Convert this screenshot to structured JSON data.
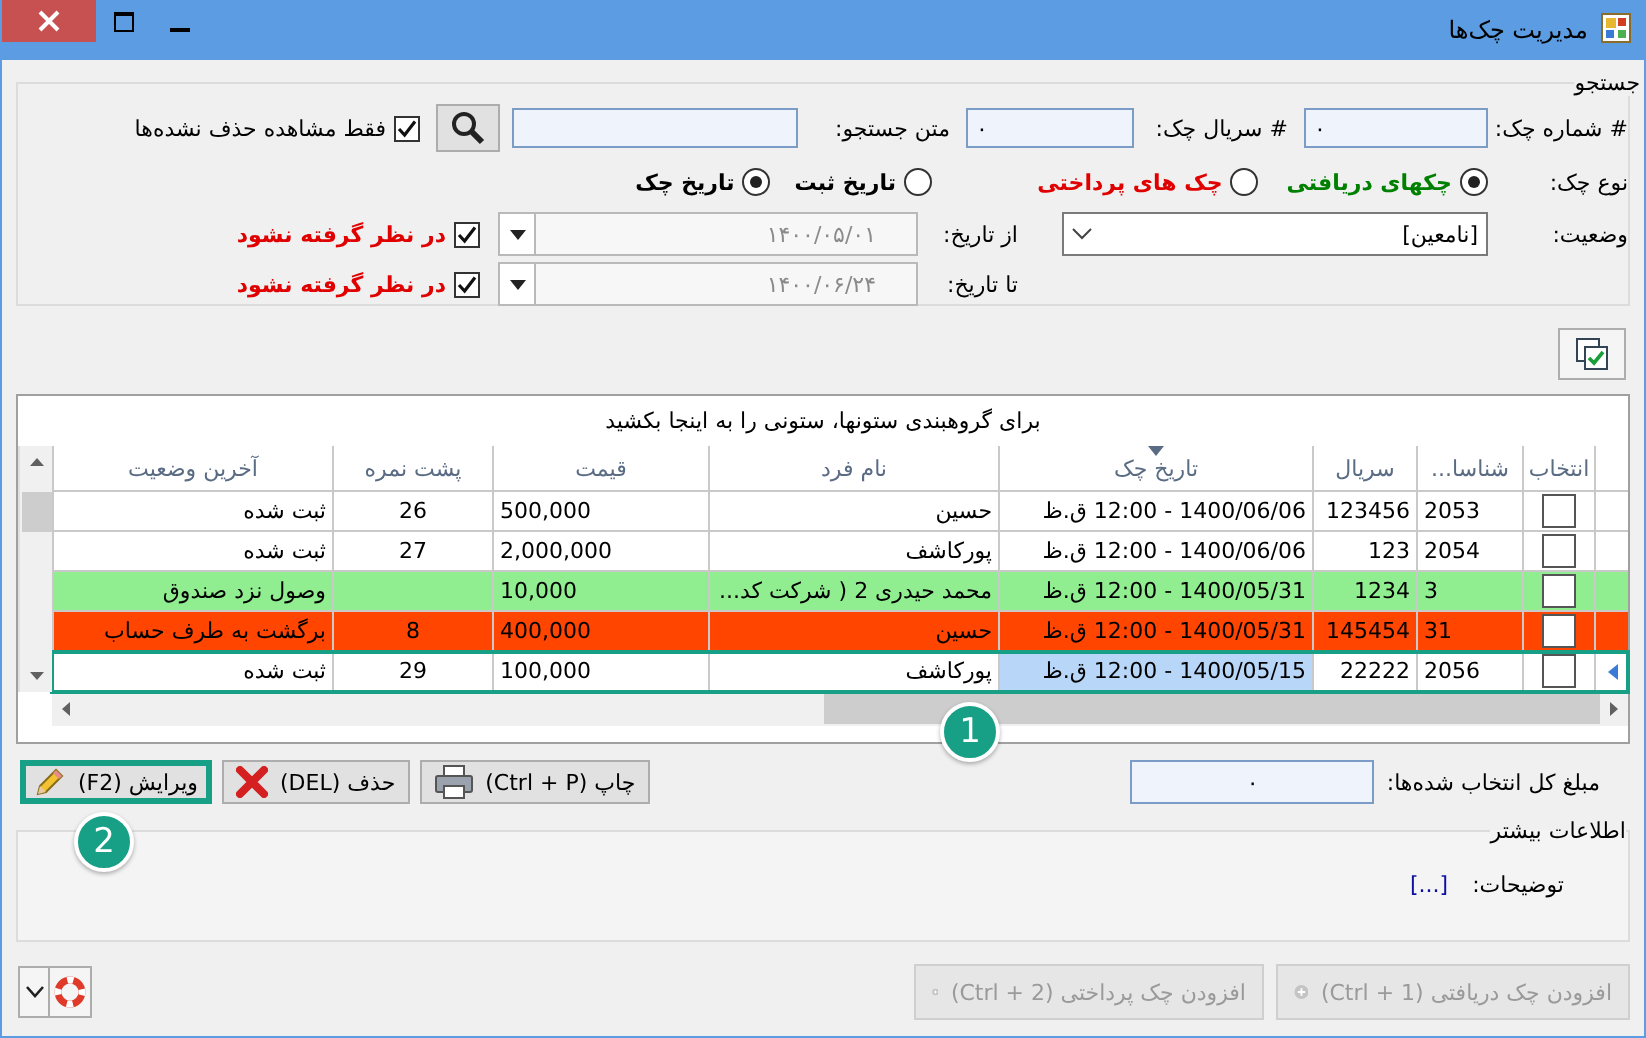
{
  "window": {
    "title": "مدیریت چک‌ها"
  },
  "search": {
    "title": "جستجو",
    "check_number": {
      "label": "# شماره چک:",
      "value": "۰"
    },
    "serial": {
      "label": "# سریال چک:",
      "value": "۰"
    },
    "text": {
      "label": "متن جستجو:"
    },
    "only_undeleted": {
      "label": "فقط مشاهده حذف نشده‌ها",
      "checked": true
    },
    "type": {
      "label": "نوع چک:",
      "options": [
        {
          "label": "چکهای دریافتی",
          "selected": true,
          "color": "#008000"
        },
        {
          "label": "چک های پرداختی",
          "selected": false,
          "color": "#e00000"
        }
      ]
    },
    "date_basis": {
      "options": [
        {
          "label": "تاریخ ثبت",
          "selected": false
        },
        {
          "label": "تاریخ چک",
          "selected": true
        }
      ]
    },
    "status": {
      "label": "وضعیت:",
      "value": "[نامعین]"
    },
    "dates": [
      {
        "label": "از تاریخ:",
        "value": "۱۴۰۰/۰۵/۰۱",
        "disabled": true,
        "ignore": {
          "label": "در نظر گرفته نشود",
          "checked": true
        }
      },
      {
        "label": "تا تاریخ:",
        "value": "۱۴۰۰/۰۶/۲۴",
        "disabled": true,
        "ignore": {
          "label": "در نظر گرفته نشود",
          "checked": true
        }
      }
    ]
  },
  "grid": {
    "group_hint": "برای گروهبندی ستونها، ستونی را به اینجا بکشید",
    "columns": [
      {
        "label": "انتخاب",
        "sorted": false
      },
      {
        "label": "شناسا...",
        "sorted": false
      },
      {
        "label": "سریال",
        "sorted": false
      },
      {
        "label": "تاریخ چک",
        "sorted": true
      },
      {
        "label": "نام فرد",
        "sorted": false
      },
      {
        "label": "قیمت",
        "sorted": false
      },
      {
        "label": "پشت نمره",
        "sorted": false
      },
      {
        "label": "آخرین وضعیت",
        "sorted": false
      }
    ],
    "rows": [
      {
        "selected": false,
        "highlighted": false,
        "cells": [
          {
            "checked": false
          },
          "2053",
          "123456",
          "1400/06/06 - 12:00 ق.ظ",
          "حسین",
          "500,000",
          "26",
          "ثبت شده"
        ]
      },
      {
        "selected": false,
        "highlighted": false,
        "cells": [
          {
            "checked": false
          },
          "2054",
          "123",
          "1400/06/06 - 12:00 ق.ظ",
          "پورکاشف",
          "2,000,000",
          "27",
          "ثبت شده"
        ]
      },
      {
        "selected": false,
        "highlighted": false,
        "color": "#90ee90",
        "cells": [
          {
            "checked": false
          },
          "3",
          "1234",
          "1400/05/31 - 12:00 ق.ظ",
          "محمد حیدری 2 ( شرکت کد...",
          "10,000",
          null,
          "وصول نزد صندوق"
        ]
      },
      {
        "selected": false,
        "highlighted": false,
        "color": "#ff4500",
        "cells": [
          {
            "checked": false
          },
          "31",
          "145454",
          "1400/05/31 - 12:00 ق.ظ",
          "حسین",
          "400,000",
          "8",
          "برگشت به طرف حساب"
        ]
      },
      {
        "selected": true,
        "highlighted": true,
        "cells": [
          {
            "checked": false
          },
          "2056",
          "22222",
          "1400/05/15 - 12:00 ق.ظ",
          "پورکاشف",
          "100,000",
          "29",
          "ثبت شده"
        ]
      }
    ]
  },
  "total": {
    "label": "مبلغ کل انتخاب شده‌ها:",
    "value": "۰"
  },
  "actions": [
    {
      "kind": "print",
      "label": "چاپ (Ctrl + P)",
      "highlighted": false
    },
    {
      "kind": "delete",
      "label": "حذف (DEL)",
      "highlighted": false
    },
    {
      "kind": "edit",
      "label": "ویرایش (F2)",
      "highlighted": true
    }
  ],
  "more_info": {
    "title": "اطلاعات بیشتر",
    "label": "توضیحات:",
    "link": "[...]"
  },
  "footer": [
    {
      "label": "افزودن چک دریافتی (Ctrl + 1)",
      "disabled": true
    },
    {
      "label": "افزودن چک پرداختی (Ctrl + 2)",
      "disabled": true
    }
  ],
  "annotations": [
    {
      "label": "1"
    },
    {
      "label": "2"
    }
  ]
}
